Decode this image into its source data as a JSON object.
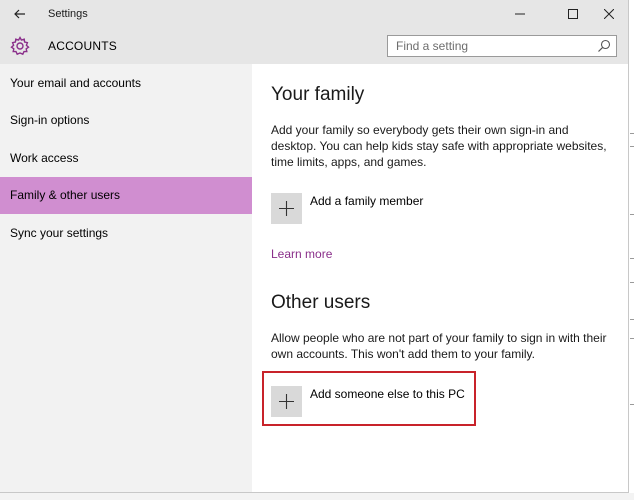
{
  "window": {
    "app_title": "Settings",
    "back_icon": "back-arrow-icon",
    "controls": [
      "minimize-icon",
      "maximize-icon",
      "close-icon"
    ]
  },
  "header": {
    "section_icon": "gear-icon",
    "section_title": "ACCOUNTS",
    "search_placeholder": "Find a setting",
    "search_value": ""
  },
  "sidebar": {
    "items": [
      {
        "label": "Your email and accounts",
        "selected": false
      },
      {
        "label": "Sign-in options",
        "selected": false
      },
      {
        "label": "Work access",
        "selected": false
      },
      {
        "label": "Family & other users",
        "selected": true
      },
      {
        "label": "Sync your settings",
        "selected": false
      }
    ]
  },
  "main": {
    "family": {
      "heading": "Your family",
      "description": "Add your family so everybody gets their own sign-in and desktop. You can help kids stay safe with appropriate websites, time limits, apps, and games.",
      "add_label": "Add a family member",
      "learn_more": "Learn more"
    },
    "other_users": {
      "heading": "Other users",
      "description": "Allow people who are not part of your family to sign in with their own accounts. This won't add them to your family.",
      "add_label": "Add someone else to this PC"
    }
  },
  "colors": {
    "accent_selected": "#d08ed0",
    "link": "#8a2f8a",
    "highlight_border": "#c8232a",
    "gear": "#8a2f8a"
  }
}
